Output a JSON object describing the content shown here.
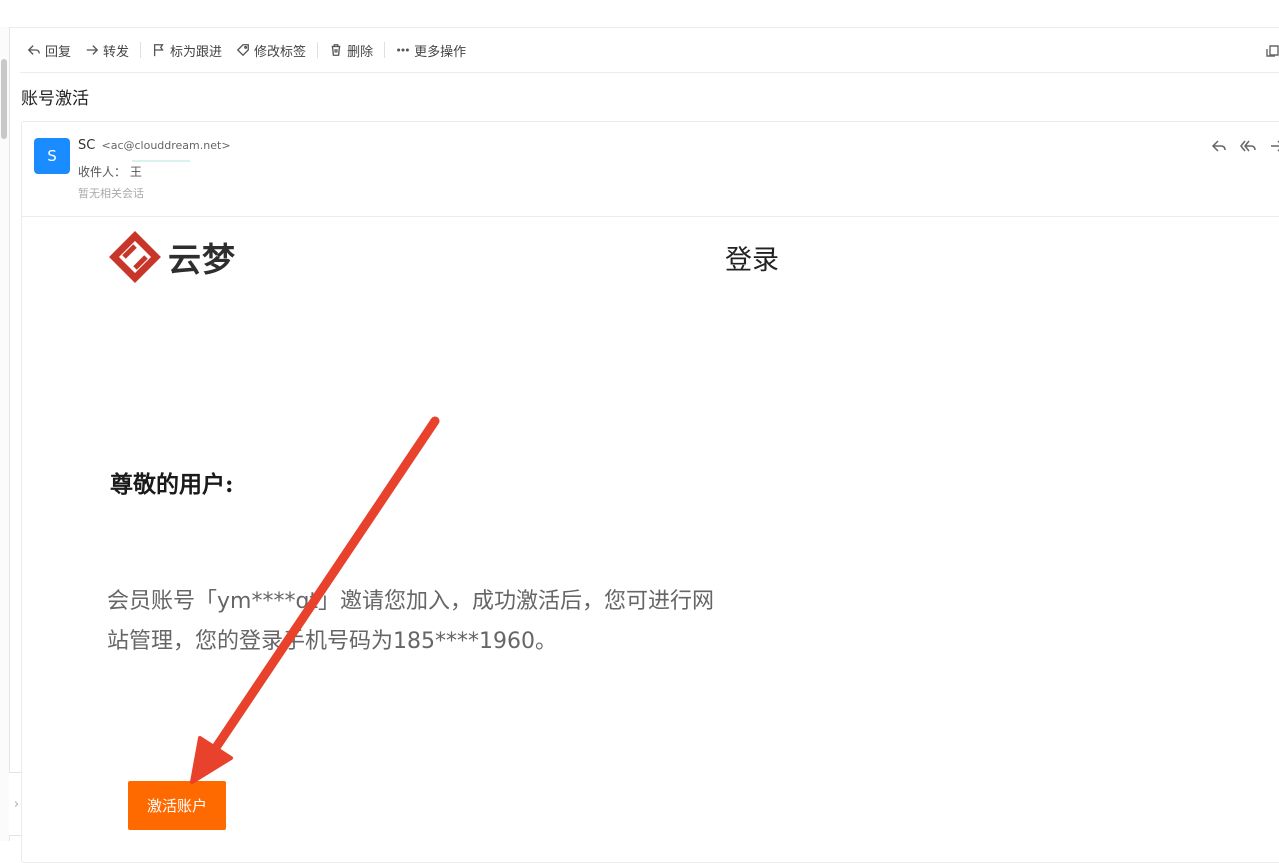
{
  "toolbar": {
    "reply": "回复",
    "forward": "转发",
    "flag": "标为跟进",
    "edit_tags": "修改标签",
    "delete": "删除",
    "more": "更多操作"
  },
  "mail": {
    "subject": "账号激活",
    "avatar_letter": "S",
    "sender_name": "SC",
    "sender_address": "<ac@clouddream.net>",
    "recipient_label": "收件人：",
    "recipient_value": "王",
    "no_related": "暂无相关会话"
  },
  "content": {
    "logo_text": "云梦",
    "login_title": "登录",
    "greeting": "尊敬的用户:",
    "body_line1": "会员账号「ym****qt」邀请您加入，成功激活后，您可进行网",
    "body_line2": "站管理，您的登录手机号码为185****1960。",
    "activate_button": "激活账户"
  },
  "colors": {
    "accent_blue": "#1a8cff",
    "logo_red": "#c8362a",
    "button_orange": "#ff6a00",
    "annotation_arrow": "#e8412c"
  },
  "icons": [
    "reply-icon",
    "forward-icon",
    "flag-icon",
    "tag-icon",
    "trash-icon",
    "more-icon",
    "reply-all-icon",
    "chevron-right-icon"
  ]
}
